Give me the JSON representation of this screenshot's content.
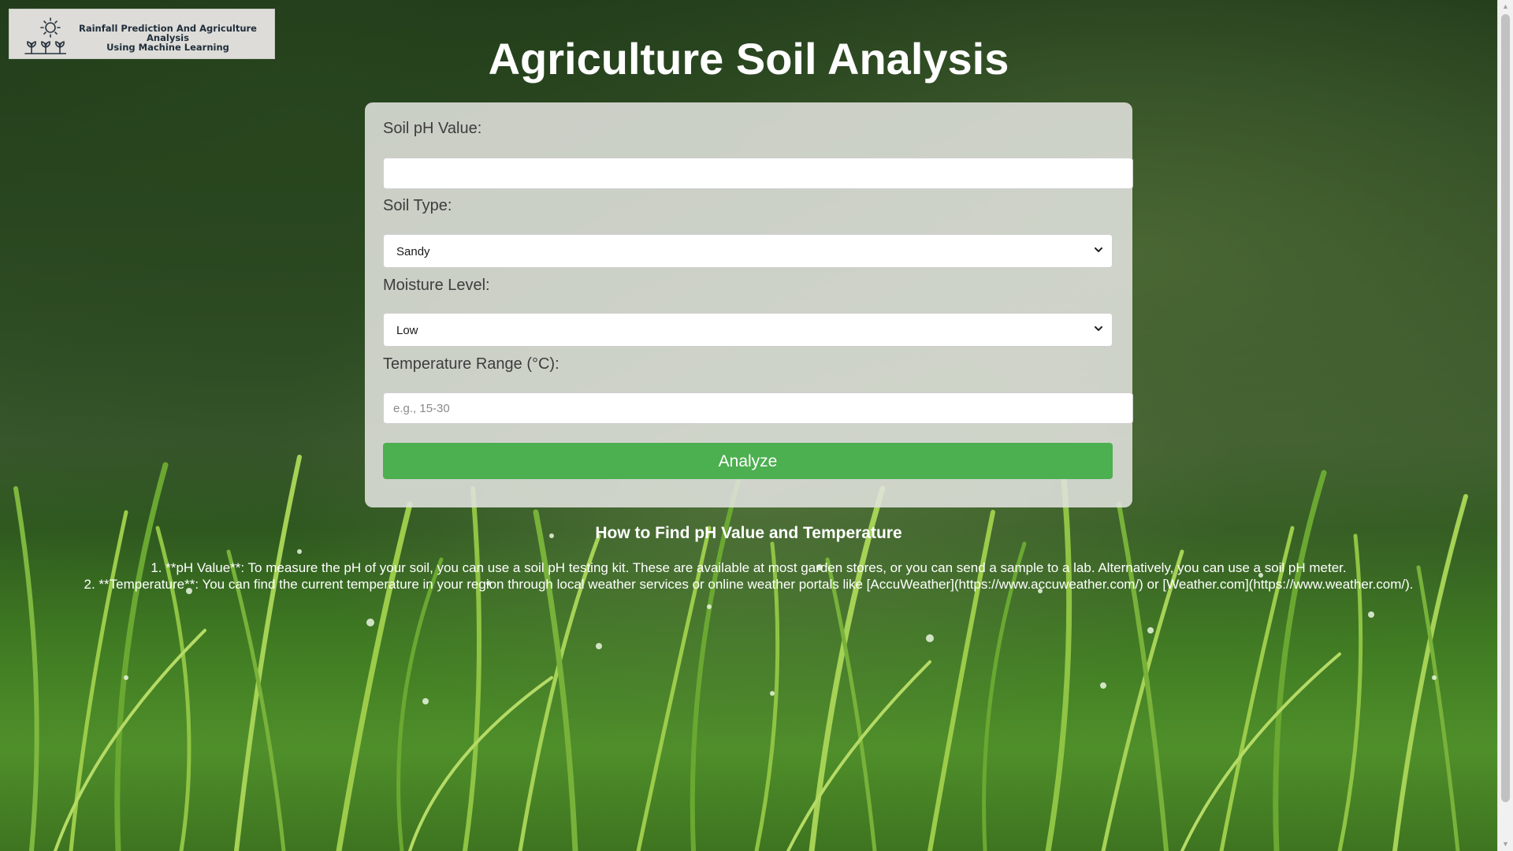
{
  "logo": {
    "line1": "Rainfall Prediction And Agriculture Analysis",
    "line2": "Using Machine Learning",
    "icon": "sun-and-sprouts-icon"
  },
  "page": {
    "title": "Agriculture Soil Analysis"
  },
  "form": {
    "ph_label": "Soil pH Value:",
    "ph_value": "",
    "soil_type_label": "Soil Type:",
    "soil_type_selected": "Sandy",
    "moisture_label": "Moisture Level:",
    "moisture_selected": "Low",
    "temperature_label": "Temperature Range (°C):",
    "temperature_placeholder": "e.g., 15-30",
    "analyze_label": "Analyze"
  },
  "help": {
    "title": "How to Find pH Value and Temperature",
    "item1": "1. **pH Value**: To measure the pH of your soil, you can use a soil pH testing kit. These are available at most garden stores, or you can send a sample to a lab. Alternatively, you can use a soil pH meter.",
    "item2": "2. **Temperature**: You can find the current temperature in your region through local weather services or online weather portals like [AccuWeather](https://www.accuweather.com/) or [Weather.com](https://www.weather.com/)."
  },
  "colors": {
    "button": "#4caf50",
    "card": "#e1e2de",
    "title": "#ffffff"
  }
}
